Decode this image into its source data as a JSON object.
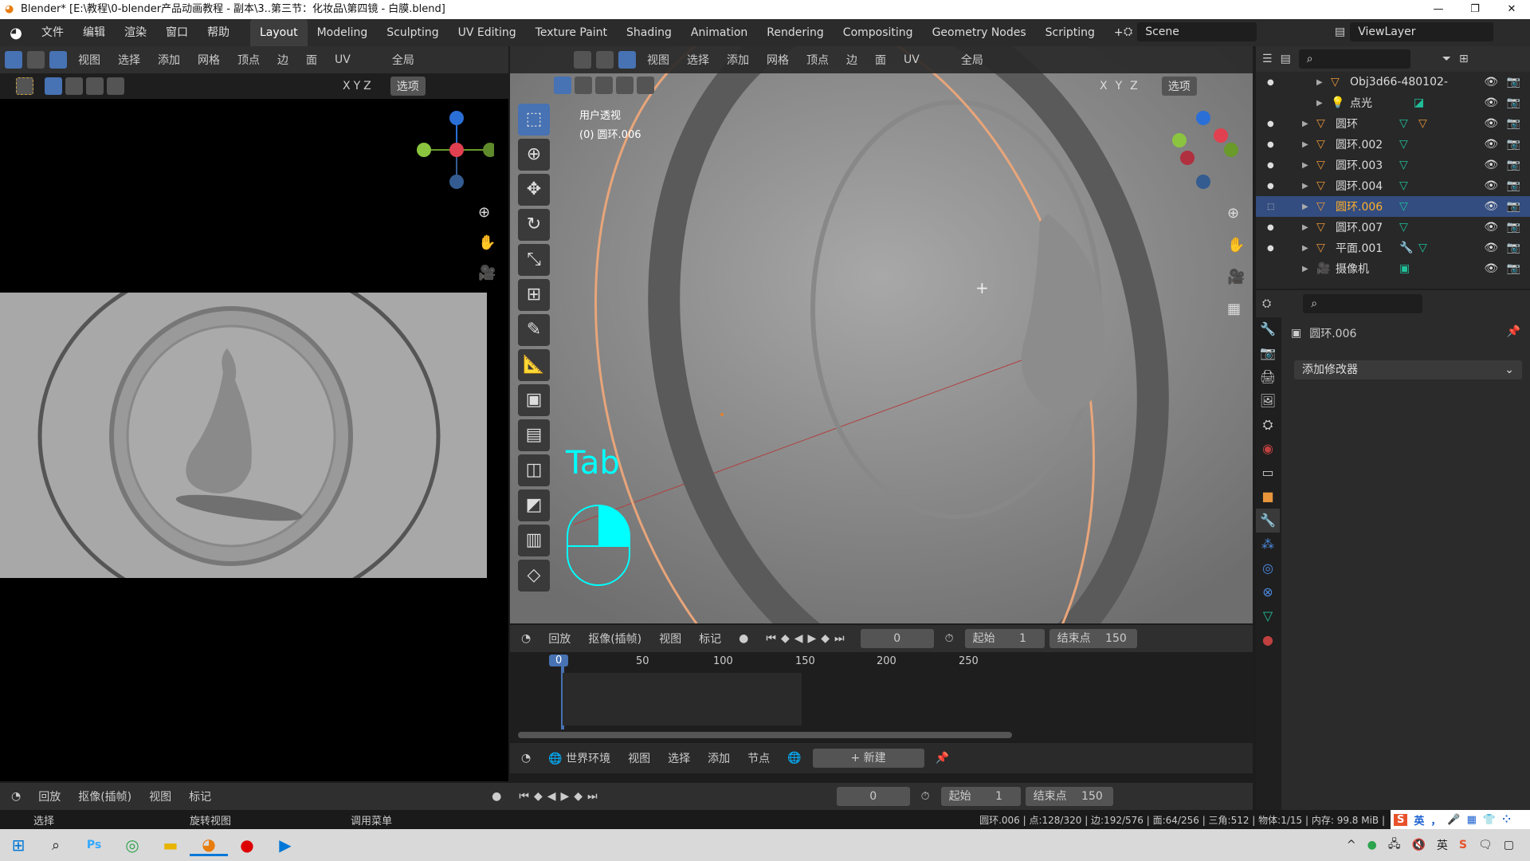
{
  "window": {
    "title": "Blender* [E:\\教程\\0-blender产品动画教程 - 副本\\3..第三节：化妆品\\第四镜 - 白膜.blend]",
    "controls": [
      "—",
      "❐",
      "✕"
    ]
  },
  "topbar": {
    "menus": [
      "文件",
      "编辑",
      "渲染",
      "窗口",
      "帮助"
    ],
    "workspaces": [
      "Layout",
      "Modeling",
      "Sculpting",
      "UV Editing",
      "Texture Paint",
      "Shading",
      "Animation",
      "Rendering",
      "Compositing",
      "Geometry Nodes",
      "Scripting"
    ],
    "active_workspace": "Layout",
    "scene": "Scene",
    "view_layer": "ViewLayer"
  },
  "left_view": {
    "menus": [
      "视图",
      "选择",
      "添加",
      "网格",
      "顶点",
      "边",
      "面",
      "UV"
    ],
    "orientation": "全局",
    "options": "选项",
    "axes": [
      "X",
      "Y",
      "Z"
    ]
  },
  "main_view": {
    "menus": [
      "视图",
      "选择",
      "添加",
      "网格",
      "顶点",
      "边",
      "面",
      "UV"
    ],
    "orientation": "全局",
    "options": "选项",
    "axes": [
      "X",
      "Y",
      "Z"
    ],
    "overlay_line1": "用户透视",
    "overlay_line2": "(0) 圆环.006",
    "key_hint": "Tab",
    "colors": {
      "accent": "#4772b3",
      "selected_edge": "#e8a57a",
      "key_hint": "#00ffff"
    }
  },
  "timeline": {
    "menus": [
      "回放",
      "抠像(插帧)",
      "视图",
      "标记"
    ],
    "current_frame": "0",
    "start_label": "起始",
    "start": "1",
    "end_label": "结束点",
    "end": "150",
    "ticks": [
      "0",
      "50",
      "100",
      "150",
      "200",
      "250"
    ]
  },
  "node_editor": {
    "world": "世界环境",
    "menus": [
      "视图",
      "选择",
      "添加",
      "节点"
    ],
    "new_label": "新建"
  },
  "bottom_timeline": {
    "menus": [
      "回放",
      "抠像(插帧)",
      "视图",
      "标记"
    ],
    "current_frame": "0",
    "start_label": "起始",
    "start": "1",
    "end_label": "结束点",
    "end": "150"
  },
  "outliner": {
    "items": [
      {
        "name": "Obj3d66-480102-",
        "icon": "mesh",
        "extras": []
      },
      {
        "name": "点光",
        "icon": "light",
        "extras": [
          "light-data"
        ]
      },
      {
        "name": "圆环",
        "icon": "mesh",
        "extras": [
          "mesh-data",
          "mesh"
        ]
      },
      {
        "name": "圆环.002",
        "icon": "mesh",
        "extras": [
          "mesh-data"
        ]
      },
      {
        "name": "圆环.003",
        "icon": "mesh",
        "extras": [
          "mesh-data"
        ]
      },
      {
        "name": "圆环.004",
        "icon": "mesh",
        "extras": [
          "mesh-data"
        ]
      },
      {
        "name": "圆环.006",
        "icon": "mesh",
        "extras": [
          "mesh-data"
        ],
        "selected": true
      },
      {
        "name": "圆环.007",
        "icon": "mesh",
        "extras": [
          "mesh-data"
        ]
      },
      {
        "name": "平面.001",
        "icon": "mesh",
        "extras": [
          "modifier",
          "mesh-data"
        ]
      },
      {
        "name": "摄像机",
        "icon": "camera",
        "extras": [
          "camera-data"
        ]
      }
    ]
  },
  "properties": {
    "object": "圆环.006",
    "add_modifier": "添加修改器"
  },
  "status": {
    "left": [
      "选择",
      "旋转视图",
      "调用菜单"
    ],
    "stats": "圆环.006 | 点:128/320 | 边:192/576 | 面:64/256 | 三角:512 | 物体:1/15 | 内存: 99.8 MiB |",
    "ime": [
      "英",
      "，",
      "🎤",
      "▦",
      "👕",
      "⁘"
    ]
  },
  "taskbar": {
    "tray_lang": "英"
  }
}
